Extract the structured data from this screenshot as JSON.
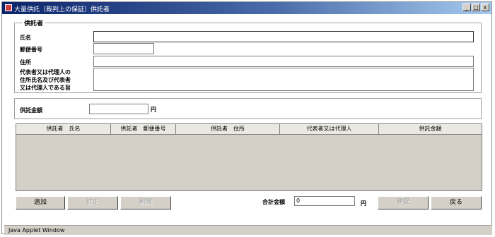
{
  "window": {
    "title": "大量供託（裁判上の保証）供託者",
    "controls": {
      "minimize": "_",
      "maximize": "□",
      "close": "x"
    }
  },
  "depositor_group": {
    "legend": "供託者",
    "fields": [
      {
        "label": "氏名",
        "value": ""
      },
      {
        "label": "郵便番号",
        "value": ""
      },
      {
        "label": "住所",
        "value": ""
      },
      {
        "label_lines": [
          "代表者又は代理人の",
          "住所氏名及び代表者",
          "又は代理人である旨"
        ],
        "value": ""
      }
    ]
  },
  "amount_group": {
    "label": "供託金額",
    "value": "",
    "unit": "円"
  },
  "table": {
    "columns": [
      "供託者　氏名",
      "供託者　郵便番号",
      "供託者　住所",
      "代表者又は代理人",
      "供託金額"
    ],
    "rows": []
  },
  "buttons": {
    "add": "追加",
    "edit": "訂正",
    "delete": "削除",
    "register": "登録",
    "back": "戻る"
  },
  "total": {
    "label": "合計金額",
    "value": "0",
    "unit": "円"
  },
  "status_bar": {
    "text": "Java Applet Window"
  }
}
